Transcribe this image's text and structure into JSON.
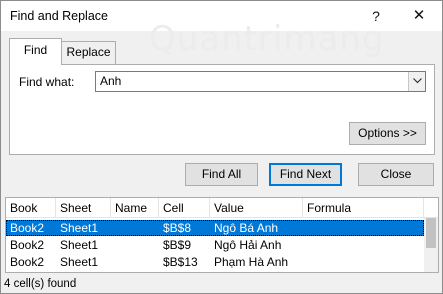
{
  "window": {
    "title": "Find and Replace",
    "help_glyph": "?",
    "close_glyph": "✕"
  },
  "tabs": [
    {
      "label": "Find",
      "active": true
    },
    {
      "label": "Replace",
      "active": false
    }
  ],
  "find": {
    "label": "Find what:",
    "value": "Anh",
    "options_label": "Options >>"
  },
  "buttons": {
    "find_all": "Find All",
    "find_next": "Find Next",
    "close": "Close"
  },
  "results": {
    "columns": [
      "Book",
      "Sheet",
      "Name",
      "Cell",
      "Value",
      "Formula"
    ],
    "rows": [
      {
        "book": "Book2",
        "sheet": "Sheet1",
        "name": "",
        "cell": "$B$8",
        "value": "Ngô Bá Anh",
        "formula": "",
        "selected": true
      },
      {
        "book": "Book2",
        "sheet": "Sheet1",
        "name": "",
        "cell": "$B$9",
        "value": "Ngô Hải Anh",
        "formula": "",
        "selected": false
      },
      {
        "book": "Book2",
        "sheet": "Sheet1",
        "name": "",
        "cell": "$B$13",
        "value": "Phạm Hà Anh",
        "formula": "",
        "selected": false
      }
    ]
  },
  "status": "4 cell(s) found",
  "watermark": "Quantrimang",
  "colors": {
    "selection": "#0078d7",
    "dialog_bg": "#f0f0f0"
  }
}
